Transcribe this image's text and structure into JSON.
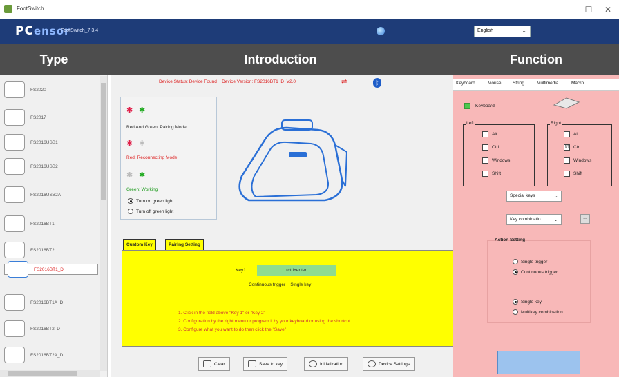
{
  "window": {
    "title": "FootSwitch",
    "controls": {
      "minimize": "—",
      "maximize": "☐",
      "close": "✕"
    }
  },
  "brand": {
    "logo_pc": "PC",
    "logo_rest": "ensor",
    "version": "FootSwitch_7.3.4",
    "language": "English"
  },
  "headers": {
    "type": "Type",
    "intro": "Introduction",
    "function": "Function"
  },
  "types": [
    {
      "label": "FS2020"
    },
    {
      "label": "FS2017"
    },
    {
      "label": "FS2016USB1"
    },
    {
      "label": "FS2016USB2"
    },
    {
      "label": "FS2016USB2A"
    },
    {
      "label": "FS2016BT1"
    },
    {
      "label": "FS2016BT2"
    },
    {
      "label": "FS2016BT1_D"
    },
    {
      "label": "FS2016BT1A_D"
    },
    {
      "label": "FS2016BT2_D"
    },
    {
      "label": "FS2016BT2A_D"
    }
  ],
  "selected_type": "FS2016BT1_D",
  "status": {
    "device_status": "Device Status: Device Found",
    "device_version": "Device Version: FS2016BT1_D_V2.0"
  },
  "leds": {
    "pairing": "Red And Green: Pairing Mode",
    "reconnecting": "Red: Reconnecting Mode",
    "working": "Green: Working",
    "radio_on": "Turn on green light",
    "radio_off": "Turn off green light"
  },
  "tabs": {
    "custom_key": "Custom Key",
    "pairing_setting": "Pairing Setting"
  },
  "custom_key": {
    "key1_label": "Key1",
    "key1_value": "rctrl+enter",
    "trigger_text": "Continuous trigger    Single key",
    "instructions": [
      "1. Click in the field above \"Key 1\" or \"Key 2\"",
      "2. Configuration by the right menu or program it by your keyboard or using the shortcut",
      "3. Configure what you want to do then click the \"Save\""
    ]
  },
  "bottom_buttons": {
    "clear": "Clear",
    "save": "Save to key",
    "init": "Initialization",
    "device": "Device Settings"
  },
  "function": {
    "tabs": [
      "Keyboard",
      "Mouse",
      "String",
      "Multimedia",
      "Macro"
    ],
    "keyboard_label": "Keyboard",
    "left_group": "Left",
    "right_group": "Right",
    "modifiers": [
      "Alt",
      "Ctrl",
      "Windows",
      "Shift"
    ],
    "right_ctrl_checked": "☑",
    "special_keys": "Special keys",
    "key_combination": "Key combinatio",
    "dots": "...",
    "action_setting": "Action Setting",
    "single_trigger": "Single trigger",
    "continuous_trigger": "Continuous trigger",
    "single_key": "Single key",
    "multikey": "Multikey  combination"
  },
  "colors": {
    "brand_bar": "#1e3c78",
    "header": "#4d4d4d",
    "function_bg": "#f8b8b8",
    "yellow_panel": "#ffff00",
    "status_red": "#dd2222"
  }
}
